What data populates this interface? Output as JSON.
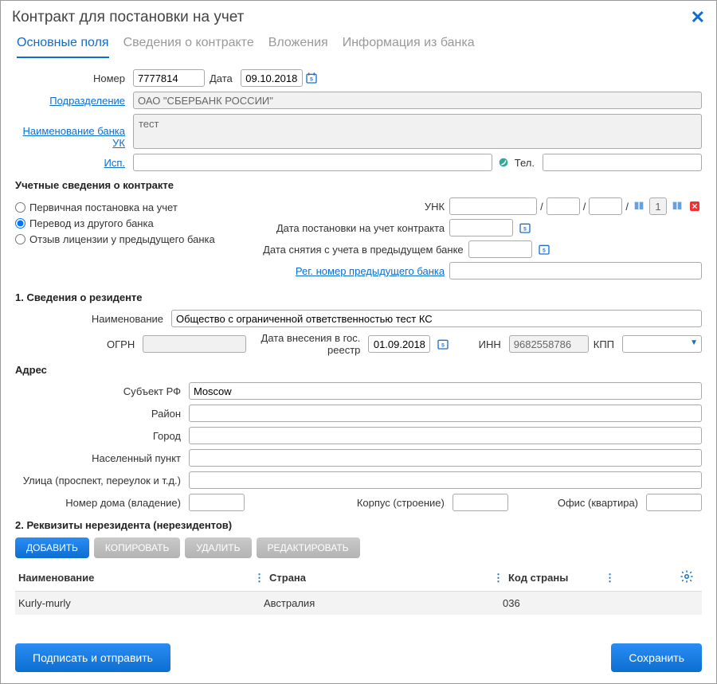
{
  "window": {
    "title": "Контракт для постановки на учет"
  },
  "tabs": [
    "Основные поля",
    "Сведения о контракте",
    "Вложения",
    "Информация из банка"
  ],
  "main": {
    "number_label": "Номер",
    "number": "7777814",
    "date_label": "Дата",
    "date": "09.10.2018",
    "division_label": "Подразделение",
    "division": "ОАО \"СБЕРБАНК РОССИИ\"",
    "bank_uk_label": "Наименование банка УК",
    "bank_uk": "тест",
    "exec_label": "Исп.",
    "exec": "",
    "phone_label": "Тел.",
    "phone": ""
  },
  "acct": {
    "section": "Учетные сведения о контракте",
    "radio1": "Первичная постановка на учет",
    "radio2": "Перевод из другого банка",
    "radio3": "Отзыв лицензии у предыдущего банка",
    "unk_label": "УНК",
    "unk_fixed": "1",
    "reg_date_label": "Дата постановки на учет контракта",
    "dereg_date_label": "Дата снятия с учета в предыдущем банке",
    "prev_reg_label": "Рег. номер предыдущего банка"
  },
  "resident": {
    "section": "1. Сведения о резиденте",
    "name_label": "Наименование",
    "name": "Общество с ограниченной ответственностью тест КС",
    "ogrn_label": "ОГРН",
    "ogrn": "",
    "regdate_label": "Дата внесения в гос. реестр",
    "regdate": "01.09.2018",
    "inn_label": "ИНН",
    "inn": "9682558786",
    "kpp_label": "КПП",
    "kpp": ""
  },
  "address": {
    "section": "Адрес",
    "subject_label": "Субъект РФ",
    "subject": "Moscow",
    "district_label": "Район",
    "city_label": "Город",
    "settlement_label": "Населенный пункт",
    "street_label": "Улица (проспект, переулок и т.д.)",
    "house_label": "Номер дома (владение)",
    "building_label": "Корпус (строение)",
    "office_label": "Офис (квартира)"
  },
  "nonres": {
    "section": "2. Реквизиты нерезидента (нерезидентов)",
    "btn_add": "ДОБАВИТЬ",
    "btn_copy": "КОПИРОВАТЬ",
    "btn_del": "УДАЛИТЬ",
    "btn_edit": "РЕДАКТИРОВАТЬ",
    "col1": "Наименование",
    "col2": "Страна",
    "col3": "Код страны",
    "rows": [
      {
        "name": "Kurly-murly",
        "country": "Австралия",
        "code": "036"
      }
    ]
  },
  "footer": {
    "sign": "Подписать и отправить",
    "save": "Сохранить"
  }
}
